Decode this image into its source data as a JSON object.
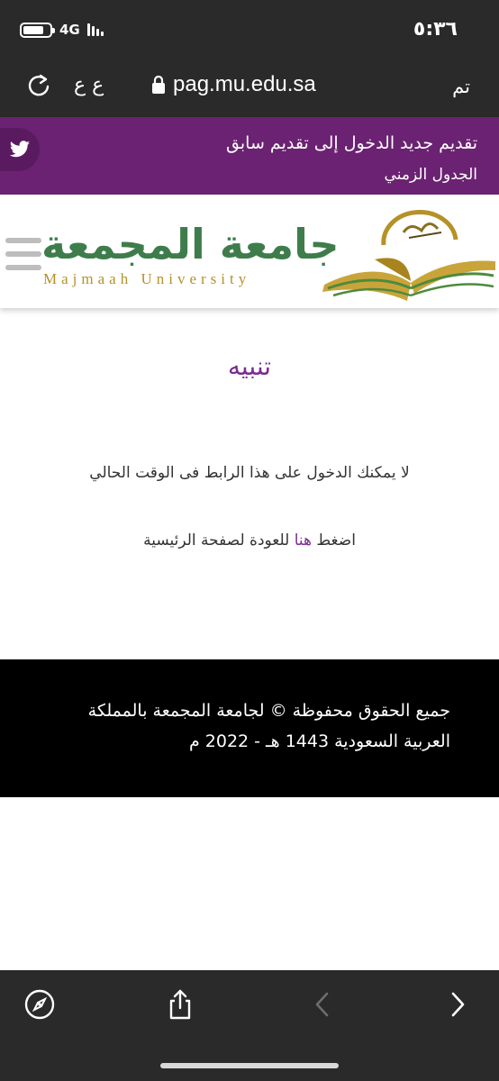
{
  "status_bar": {
    "time": "٥:٣٦",
    "network": "4G"
  },
  "browser": {
    "text_size_label": "ع ع",
    "url": "pag.mu.edu.sa",
    "done_label": "تم"
  },
  "nav": {
    "line1": "تقديم جديد الدخول إلى تقديم سابق",
    "line2": "الجدول الزمني"
  },
  "logo": {
    "arabic": "جامعة المجمعة",
    "english": "Majmaah University"
  },
  "notice": {
    "title": "تنبيه",
    "message": "لا يمكنك الدخول على هذا الرابط فى الوقت الحالي",
    "back_prefix": "اضغط",
    "back_link": "هنا",
    "back_suffix": "للعودة لصفحة الرئيسية"
  },
  "footer": {
    "line1": "جميع الحقوق محفوظة © لجامعة المجمعة بالمملكة",
    "line2": "العربية السعودية 1443 هـ - 2022 م"
  },
  "colors": {
    "purple": "#6b2272",
    "accent": "#7b2d8e",
    "logo_green": "#3e7d4b",
    "logo_gold": "#b59128",
    "chrome": "#2a2a2a"
  },
  "icons": [
    "battery-icon",
    "signal-icon",
    "reload-icon",
    "lock-icon",
    "twitter-icon",
    "hamburger-menu-icon",
    "book-logo-icon",
    "compass-icon",
    "share-icon",
    "back-arrow-icon",
    "forward-arrow-icon"
  ]
}
